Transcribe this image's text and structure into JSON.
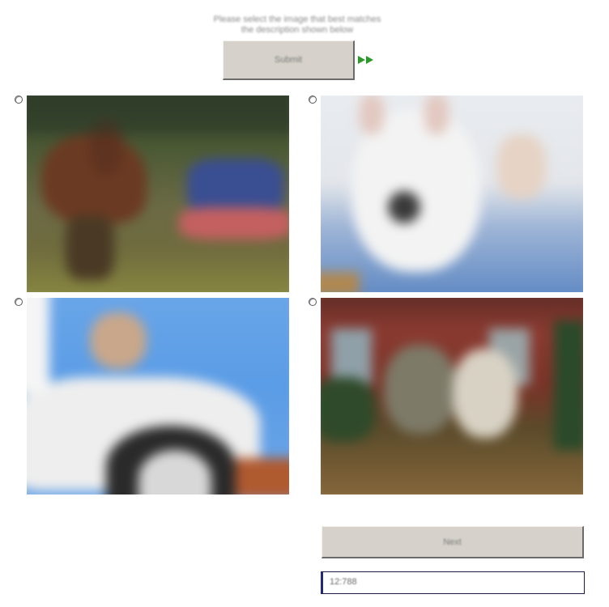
{
  "instruction": {
    "line1": "Please select the image that best matches",
    "line2": "the description shown below"
  },
  "top_button": {
    "label": "Submit"
  },
  "bottom_button": {
    "label": "Next"
  },
  "field": {
    "value": "12:788"
  },
  "icons": {
    "skip": "fast-forward-icon"
  },
  "colors": {
    "button_face": "#d6d2cb",
    "skip_arrow": "#2b9a2b",
    "field_border": "#1f2a7a"
  },
  "options": [
    {
      "id": "option-1",
      "subject": "horse",
      "selected": false
    },
    {
      "id": "option-2",
      "subject": "dog",
      "selected": false
    },
    {
      "id": "option-3",
      "subject": "truck",
      "selected": false
    },
    {
      "id": "option-4",
      "subject": "chickens",
      "selected": false
    }
  ]
}
